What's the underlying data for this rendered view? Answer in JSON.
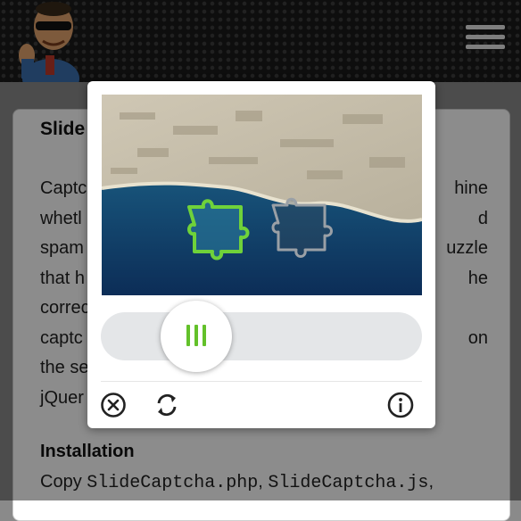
{
  "header": {
    "logo_icon": "cartoon-mascot-logo-icon",
    "menu_icon": "hamburger-menu-icon"
  },
  "article": {
    "title": "Slide",
    "lines": [
      "Captc",
      "whetl",
      "spam",
      "that h",
      "correc",
      "captc",
      "the se",
      "jQuer"
    ],
    "line_ends": [
      "hine",
      "d",
      "uzzle",
      "he",
      "",
      "on",
      "",
      ""
    ],
    "installation_heading": "Installation",
    "install_prefix": "Copy ",
    "install_file1": "SlideCaptcha.php",
    "install_sep": ", ",
    "install_file2": "SlideCaptcha.js",
    "install_suffix": ","
  },
  "captcha": {
    "image_icon": "aerial-coastline-puzzle-image",
    "piece_icon": "puzzle-piece-icon",
    "slot_icon": "puzzle-slot-icon",
    "slider_position": 0.24,
    "handle_icon": "grip-bars-icon",
    "accent_color": "#63c12a",
    "tools": {
      "close_icon": "close-circle-icon",
      "refresh_icon": "refresh-icon",
      "info_icon": "info-circle-icon"
    }
  }
}
